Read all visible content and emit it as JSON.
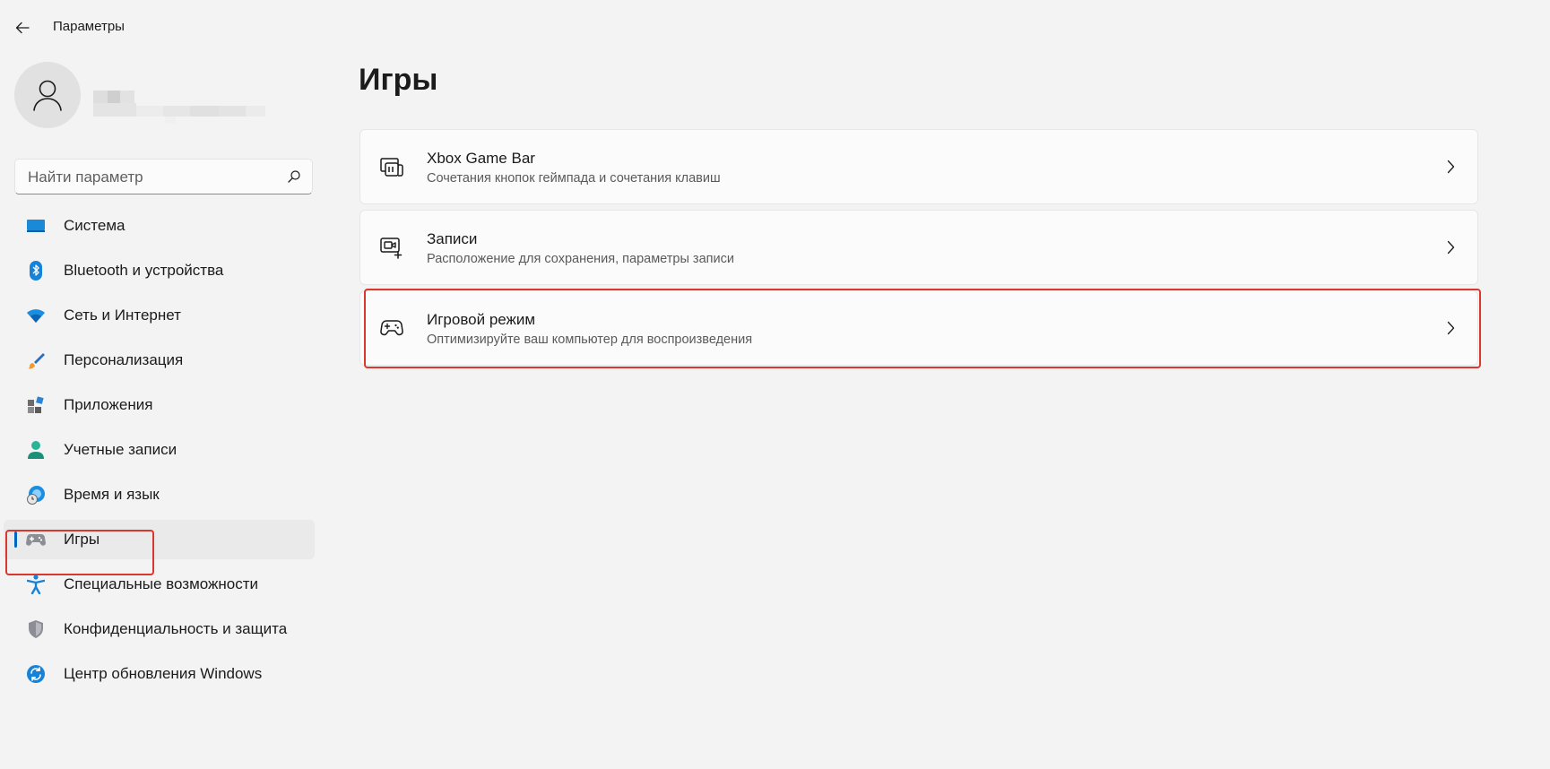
{
  "window": {
    "title": "Параметры"
  },
  "search": {
    "placeholder": "Найти параметр"
  },
  "sidebar": {
    "items": [
      {
        "label": "Система",
        "icon": "system-icon"
      },
      {
        "label": "Bluetooth и устройства",
        "icon": "bluetooth-icon"
      },
      {
        "label": "Сеть и Интернет",
        "icon": "wifi-icon"
      },
      {
        "label": "Персонализация",
        "icon": "brush-icon"
      },
      {
        "label": "Приложения",
        "icon": "apps-icon"
      },
      {
        "label": "Учетные записи",
        "icon": "account-icon"
      },
      {
        "label": "Время и язык",
        "icon": "time-language-icon"
      },
      {
        "label": "Игры",
        "icon": "gamepad-icon",
        "selected": true
      },
      {
        "label": "Специальные возможности",
        "icon": "accessibility-icon"
      },
      {
        "label": "Конфиденциальность и защита",
        "icon": "shield-icon"
      },
      {
        "label": "Центр обновления Windows",
        "icon": "update-icon"
      }
    ]
  },
  "main": {
    "title": "Игры",
    "cards": [
      {
        "title": "Xbox Game Bar",
        "subtitle": "Сочетания кнопок геймпада и сочетания клавиш",
        "icon": "game-bar-icon"
      },
      {
        "title": "Записи",
        "subtitle": "Расположение для сохранения, параметры записи",
        "icon": "capture-icon"
      },
      {
        "title": "Игровой режим",
        "subtitle": "Оптимизируйте ваш компьютер для воспроизведения",
        "icon": "gamepad-icon"
      }
    ]
  },
  "colors": {
    "accent": "#0067c0",
    "highlight": "#d9382f",
    "background": "#f3f3f3"
  }
}
